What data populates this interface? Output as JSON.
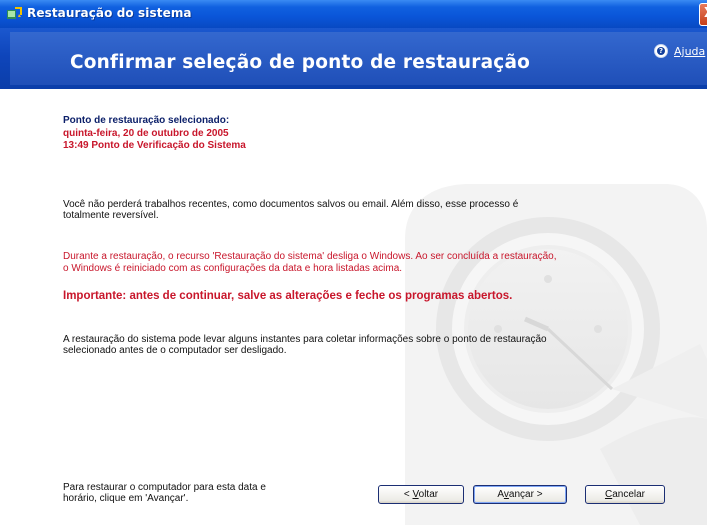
{
  "window": {
    "title": "Restauração do sistema",
    "close_label": "X"
  },
  "header": {
    "title": "Confirmar seleção de ponto de restauração",
    "help_label": "Ajuda"
  },
  "main": {
    "selected_point_label": "Ponto de restauração selecionado:",
    "selected_date": "quinta-feira, 20 de outubro de 2005",
    "selected_detail": "13:49 Ponto de Verificação do Sistema",
    "info_line1": "Você não perderá trabalhos recentes, como documentos salvos ou email. Além disso, esse processo é",
    "info_line2": "totalmente reversível.",
    "warning_line1": "Durante a restauração, o recurso 'Restauração do sistema' desliga o Windows. Ao ser concluída a restauração,",
    "warning_line2": "o Windows é reiniciado com as configurações da data e hora listadas acima.",
    "important": "Importante: antes de continuar, salve as alterações e feche os programas abertos.",
    "time_line1": "A restauração do sistema pode levar alguns instantes para coletar informações sobre o ponto de restauração",
    "time_line2": "selecionado antes de o computador ser desligado.",
    "footer_line1": "Para restaurar o computador para esta data e",
    "footer_line2": "horário, clique em 'Avançar'."
  },
  "buttons": {
    "back_prefix": "< ",
    "back_key": "V",
    "back_rest": "oltar",
    "next_prefix": "",
    "next_key": "A",
    "next_mid": "v",
    "next_rest": "ançar >",
    "cancel_key": "C",
    "cancel_rest": "ancelar"
  },
  "colors": {
    "accent": "#0b3ea9",
    "title_text_blue": "#0b1f69",
    "warning_red": "#c8162b"
  }
}
